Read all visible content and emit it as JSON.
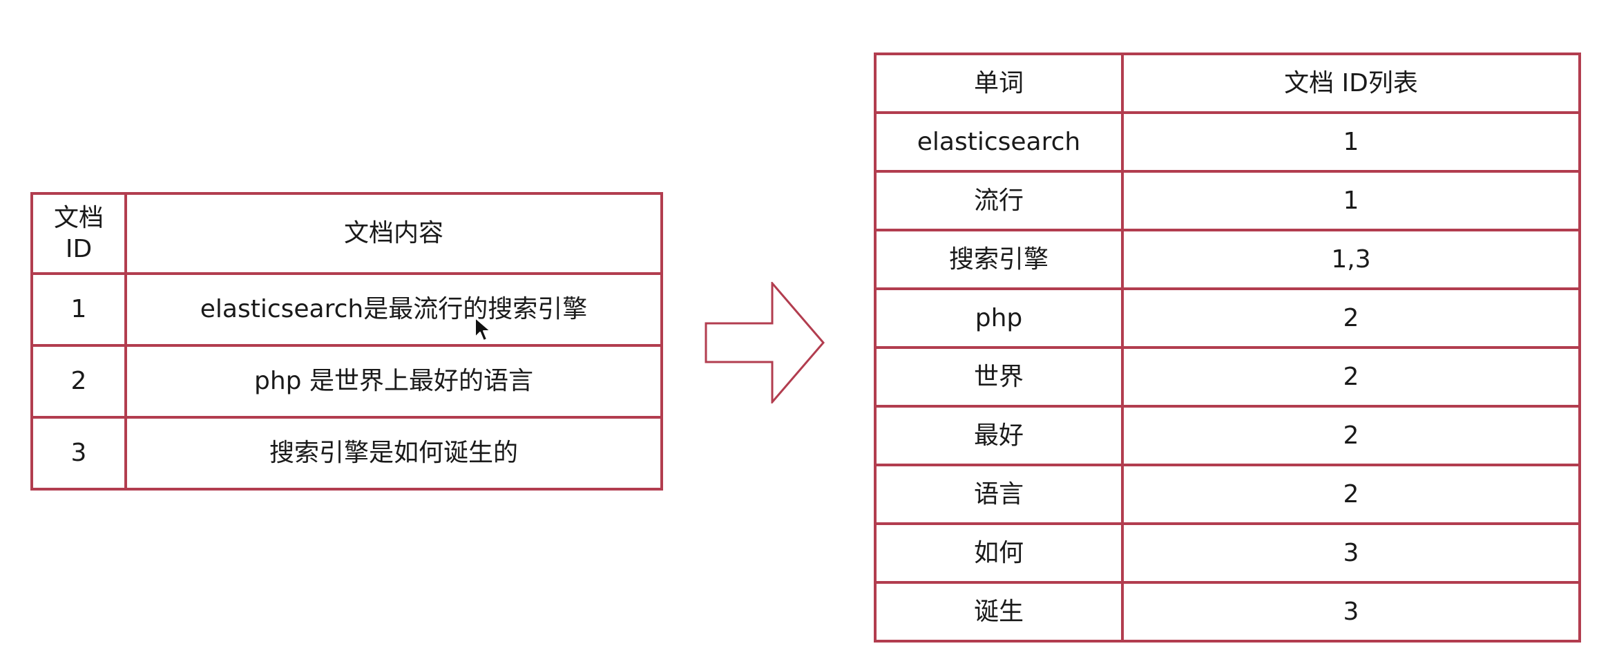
{
  "docs_table": {
    "header": {
      "id_line1": "文档",
      "id_line2": "ID",
      "content": "文档内容"
    },
    "rows": [
      {
        "id": "1",
        "content": "elasticsearch是最流行的搜索引擎"
      },
      {
        "id": "2",
        "content": "php 是世界上最好的语言"
      },
      {
        "id": "3",
        "content": "搜索引擎是如何诞生的"
      }
    ]
  },
  "inverted_index": {
    "header": {
      "term": "单词",
      "doc_ids": "文档 ID列表"
    },
    "rows": [
      {
        "term": "elasticsearch",
        "doc_ids": "1"
      },
      {
        "term": "流行",
        "doc_ids": "1"
      },
      {
        "term": "搜索引擎",
        "doc_ids": "1,3"
      },
      {
        "term": "php",
        "doc_ids": "2"
      },
      {
        "term": "世界",
        "doc_ids": "2"
      },
      {
        "term": "最好",
        "doc_ids": "2"
      },
      {
        "term": "语言",
        "doc_ids": "2"
      },
      {
        "term": "如何",
        "doc_ids": "3"
      },
      {
        "term": "诞生",
        "doc_ids": "3"
      }
    ]
  },
  "colors": {
    "border": "#b23d4f",
    "text": "#1a1a1a",
    "background": "#ffffff"
  },
  "icons": {
    "arrow": "right-arrow-icon",
    "cursor": "mouse-cursor-icon"
  }
}
